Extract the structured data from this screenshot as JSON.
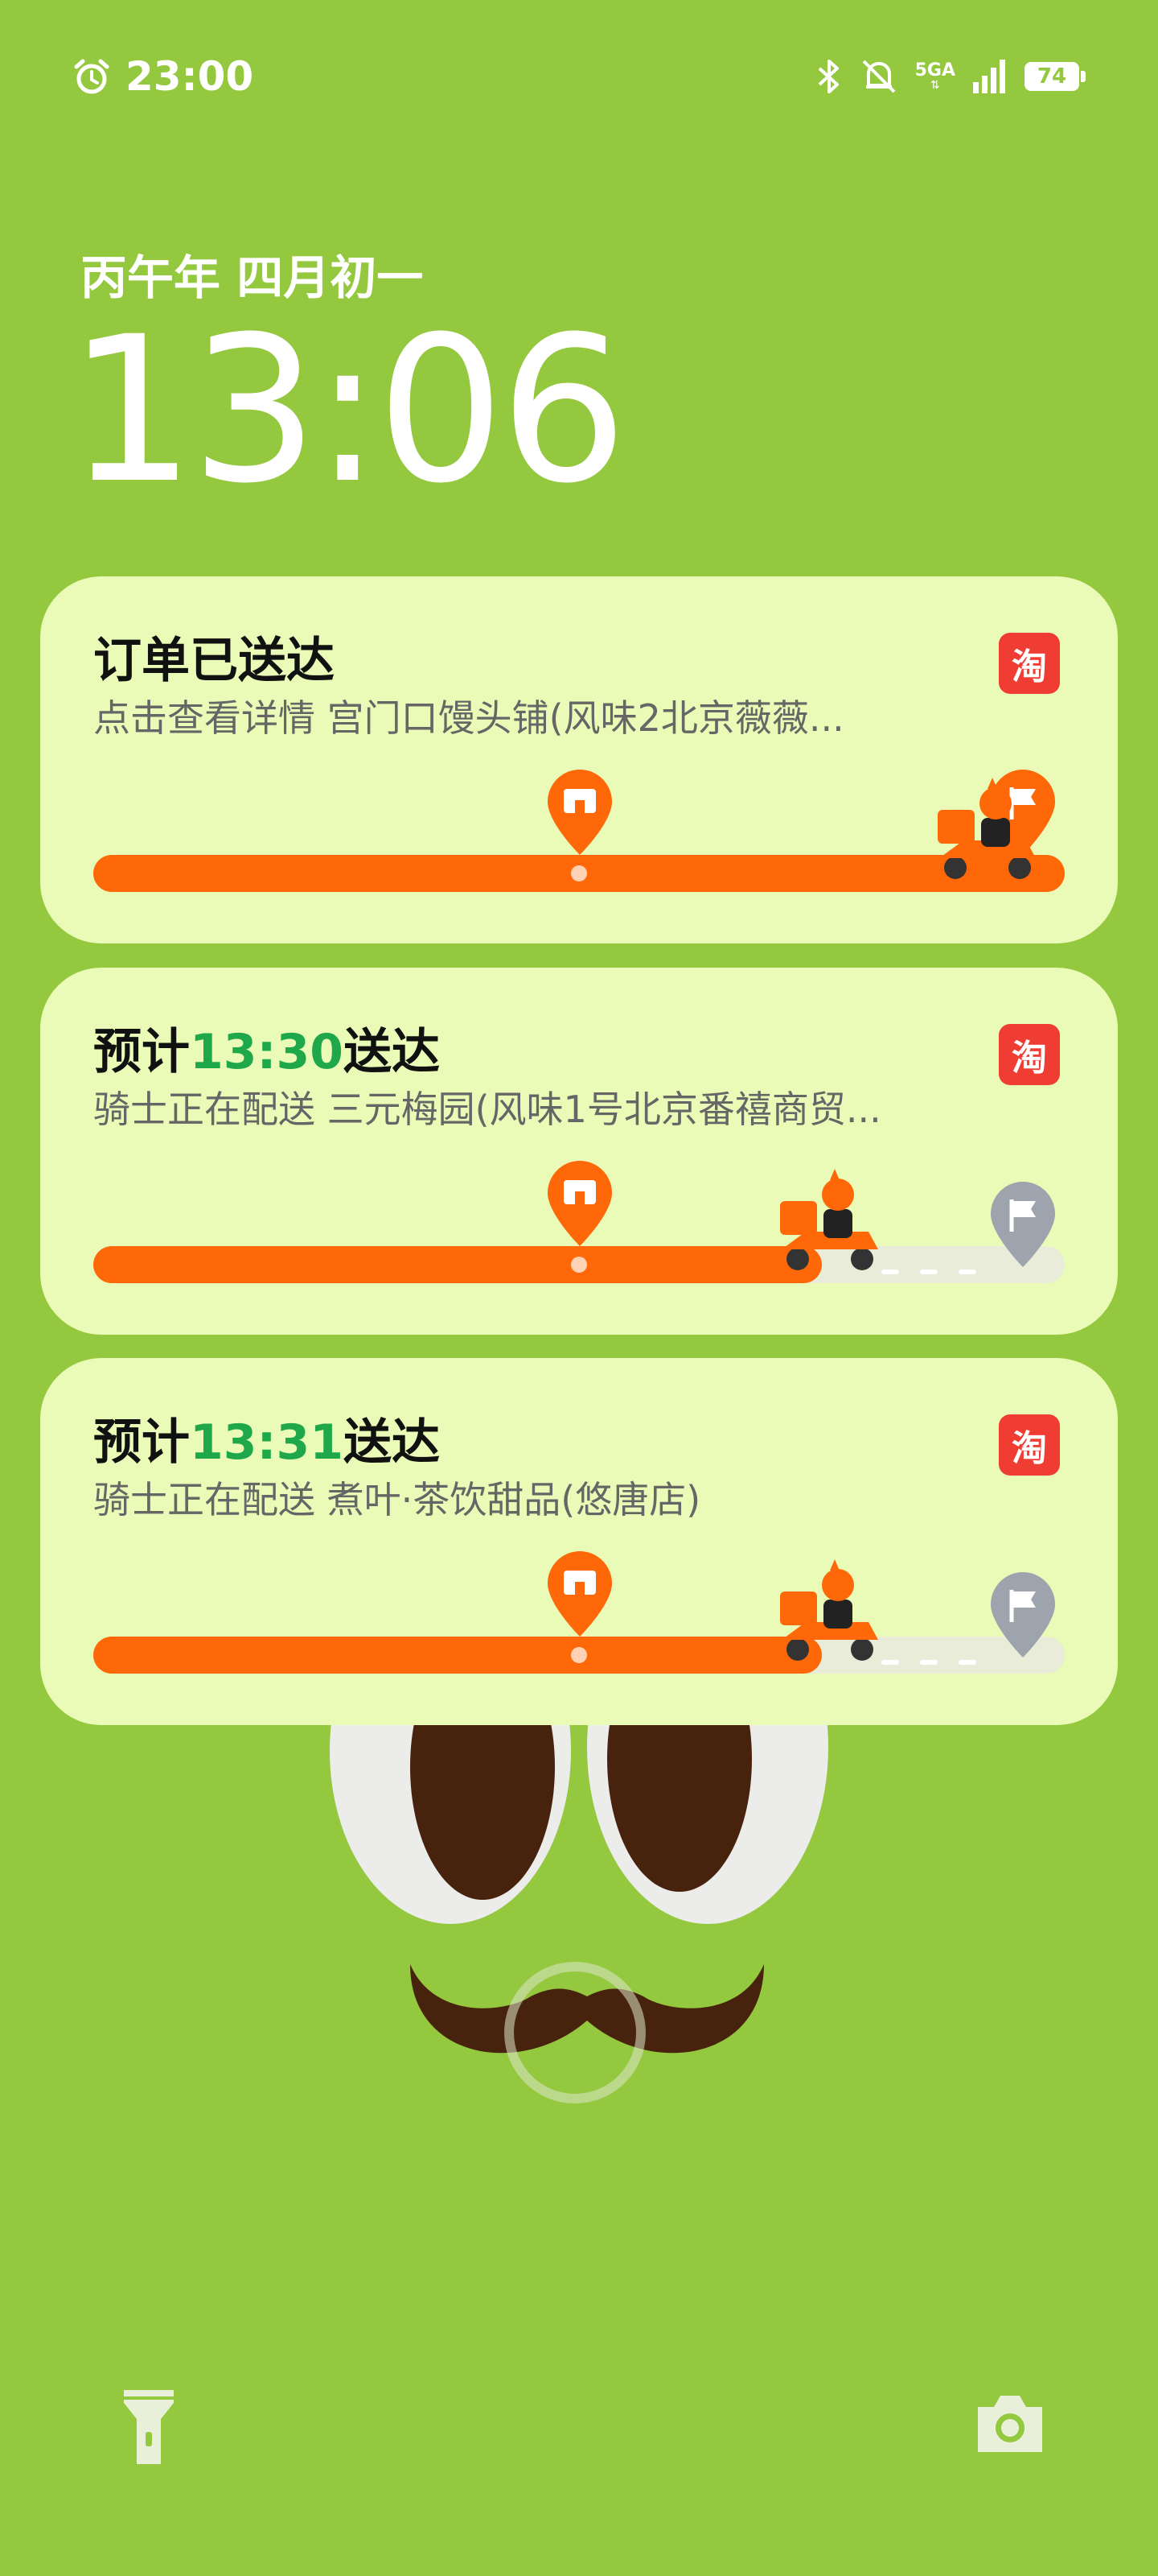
{
  "status_bar": {
    "time": "23:00",
    "network_label": "5GA",
    "battery_level": "74",
    "icons": [
      "alarm-icon",
      "bluetooth-icon",
      "mute-icon",
      "signal-icon",
      "battery-icon"
    ]
  },
  "lock": {
    "lunar_date": "丙午年 四月初一",
    "time": "13:06"
  },
  "notifications": [
    {
      "title": "订单已送达",
      "subtitle": "点击查看详情 宫门口馒头铺(风味2北京薇薇...",
      "app_badge": "淘",
      "progress": 1.0,
      "status": "delivered"
    },
    {
      "title_prefix": "预计",
      "eta": "13:30",
      "title_suffix": "送达",
      "subtitle": "骑士正在配送 三元梅园(风味1号北京番禧商贸...",
      "app_badge": "淘",
      "progress": 0.75,
      "status": "delivering"
    },
    {
      "title_prefix": "预计",
      "eta": "13:31",
      "title_suffix": "送达",
      "subtitle": "骑士正在配送 煮叶·茶饮甜品(悠唐店)",
      "app_badge": "淘",
      "progress": 0.75,
      "status": "delivering"
    }
  ],
  "colors": {
    "wallpaper": "#94c83f",
    "card": "#eafbb7",
    "accent_orange": "#fe6808",
    "eta_green": "#1fa84a",
    "badge_red": "#ef3d34"
  }
}
